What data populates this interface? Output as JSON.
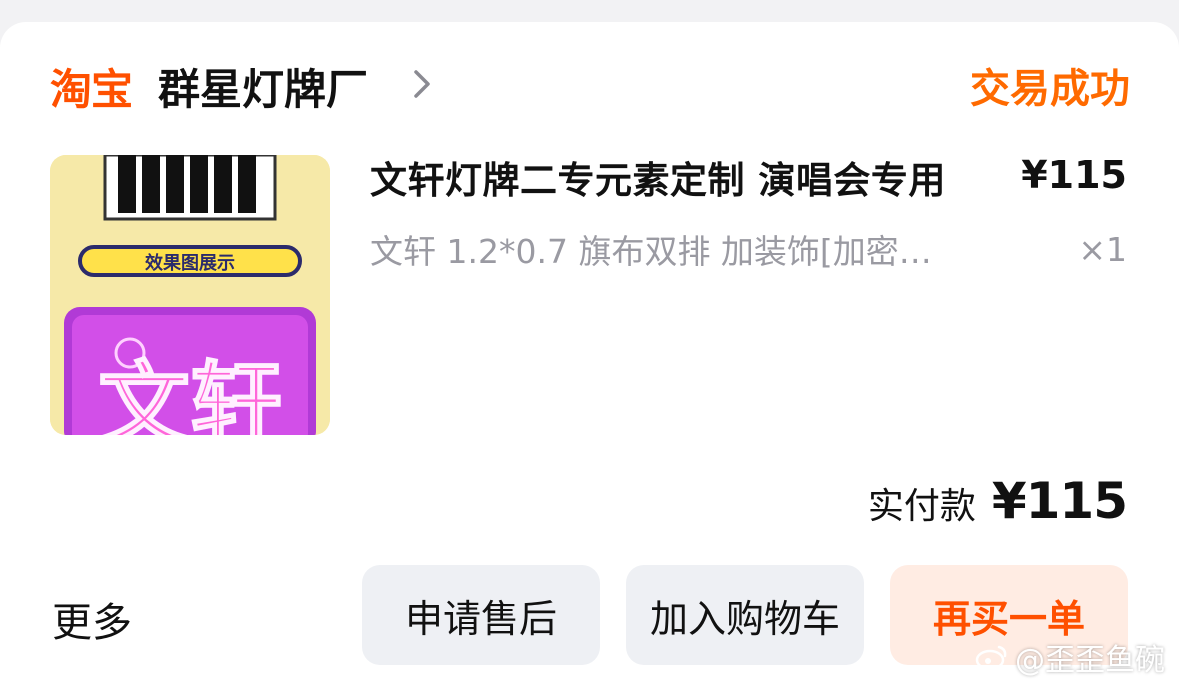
{
  "header": {
    "brand": "淘宝",
    "shop_name": "群星灯牌厂",
    "status": "交易成功"
  },
  "item": {
    "thumbnail": {
      "banner_label": "效果图展示",
      "sign_text": "文轩"
    },
    "title": "文轩灯牌二专元素定制 演唱会专用",
    "price": "¥115",
    "spec": "文轩 1.2*0.7  旗布双排  加装饰[加密…",
    "quantity": "×1"
  },
  "payment": {
    "label": "实付款",
    "value": "¥115"
  },
  "actions": {
    "more": "更多",
    "after_sale": "申请售后",
    "add_to_cart": "加入购物车",
    "rebuy": "再买一单"
  },
  "watermark": "@歪歪鱼碗",
  "colors": {
    "accent": "#ff5000",
    "status": "#ff6a00",
    "button_bg": "#eef0f4",
    "rebuy_bg": "#ffece3"
  }
}
